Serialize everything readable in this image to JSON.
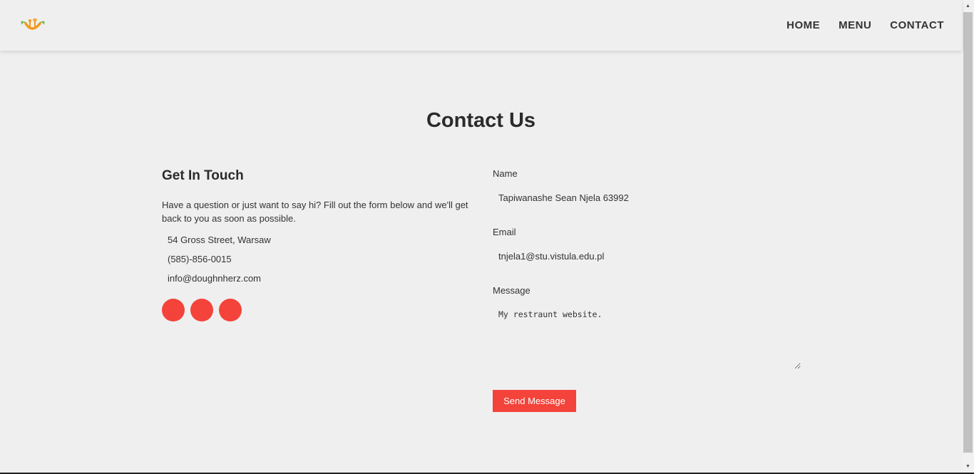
{
  "nav": {
    "logo": "restaurant-logo",
    "links": [
      "HOME",
      "MENU",
      "CONTACT"
    ]
  },
  "page": {
    "title": "Contact Us"
  },
  "info": {
    "heading": "Get In Touch",
    "intro": "Have a question or just want to say hi? Fill out the form below and we'll get back to you as soon as possible.",
    "address": "54 Gross Street, Warsaw",
    "phone": "(585)-856-0015",
    "email": "info@doughnherz.com",
    "social_color": "#f4433a"
  },
  "form": {
    "name_label": "Name",
    "name_value": "Tapiwanashe Sean Njela 63992",
    "email_label": "Email",
    "email_value": "tnjela1@stu.vistula.edu.pl",
    "message_label": "Message",
    "message_value": "My restraunt website.",
    "submit_label": "Send Message"
  },
  "colors": {
    "accent": "#f4433a",
    "background": "#efefef",
    "text": "#333333"
  }
}
